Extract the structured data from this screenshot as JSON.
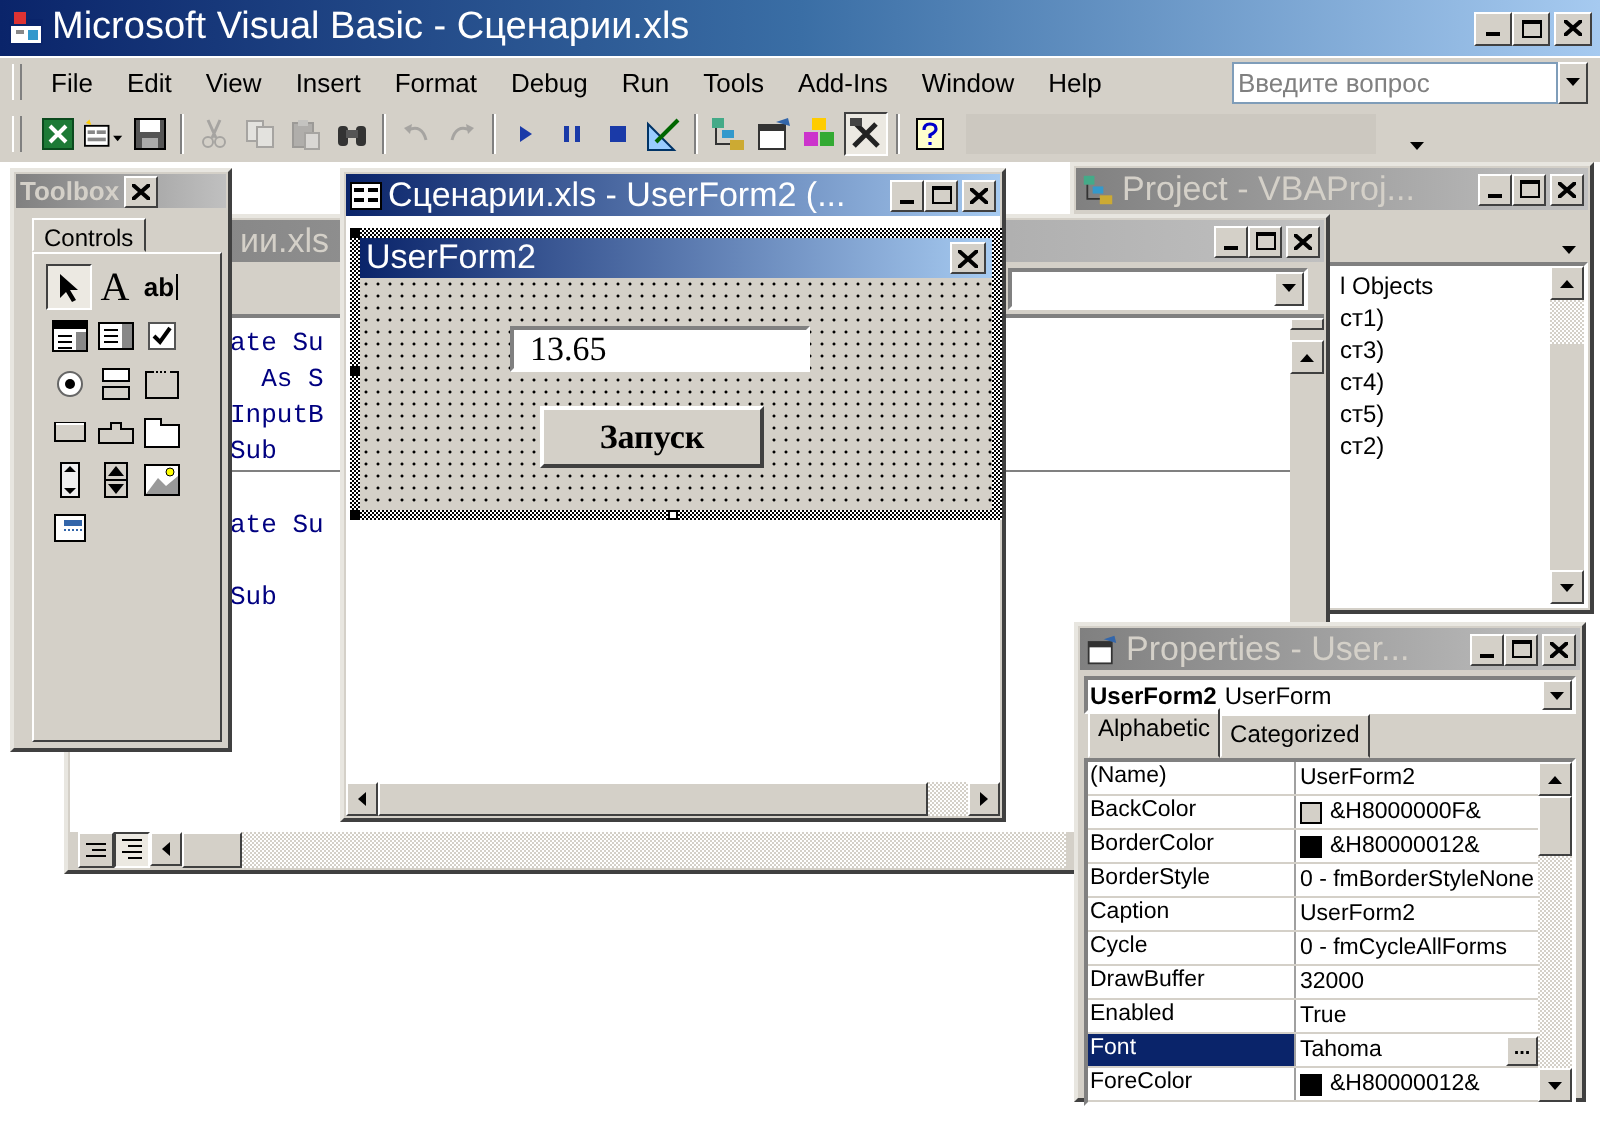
{
  "window": {
    "title": "Microsoft Visual Basic - Сценарии.xls"
  },
  "menu": [
    "File",
    "Edit",
    "View",
    "Insert",
    "Format",
    "Debug",
    "Run",
    "Tools",
    "Add-Ins",
    "Window",
    "Help"
  ],
  "help_box": {
    "placeholder": "Введите вопрос"
  },
  "toolbar": [
    {
      "kind": "excel",
      "disabled": false,
      "pressed": false
    },
    {
      "kind": "insert-form",
      "disabled": false,
      "pressed": false
    },
    {
      "kind": "save",
      "disabled": false,
      "pressed": false
    },
    {
      "kind": "separator"
    },
    {
      "kind": "cut",
      "disabled": true,
      "pressed": false
    },
    {
      "kind": "copy",
      "disabled": true,
      "pressed": false
    },
    {
      "kind": "paste",
      "disabled": true,
      "pressed": false
    },
    {
      "kind": "find",
      "disabled": false,
      "pressed": false
    },
    {
      "kind": "separator"
    },
    {
      "kind": "undo",
      "disabled": true,
      "pressed": false
    },
    {
      "kind": "redo",
      "disabled": true,
      "pressed": false
    },
    {
      "kind": "separator"
    },
    {
      "kind": "run",
      "disabled": false,
      "pressed": false
    },
    {
      "kind": "pause",
      "disabled": false,
      "pressed": false
    },
    {
      "kind": "stop",
      "disabled": false,
      "pressed": false
    },
    {
      "kind": "design",
      "disabled": false,
      "pressed": false
    },
    {
      "kind": "separator"
    },
    {
      "kind": "project",
      "disabled": false,
      "pressed": false
    },
    {
      "kind": "properties",
      "disabled": false,
      "pressed": false
    },
    {
      "kind": "browser",
      "disabled": false,
      "pressed": false
    },
    {
      "kind": "toolbox",
      "disabled": false,
      "pressed": true
    },
    {
      "kind": "separator"
    },
    {
      "kind": "help",
      "disabled": false,
      "pressed": false
    }
  ],
  "code_window": {
    "title": "ии.xls",
    "active": false,
    "lines": [
      {
        "kind": "code",
        "text": "ate Su"
      },
      {
        "kind": "code",
        "text": "  As S"
      },
      {
        "kind": "code",
        "text": "InputB"
      },
      {
        "kind": "code",
        "text": "Sub"
      },
      {
        "kind": "separator"
      },
      {
        "kind": "blank"
      },
      {
        "kind": "code",
        "text": "ate Su"
      },
      {
        "kind": "blank"
      },
      {
        "kind": "code",
        "text": "Sub"
      }
    ]
  },
  "project": {
    "title": "Project - VBAProj...",
    "active": false,
    "items": [
      "l Objects",
      "ст1)",
      "ст3)",
      "ст4)",
      "ст5)",
      "ст2)"
    ]
  },
  "properties": {
    "title": "Properties - User...",
    "active": false,
    "object": {
      "name": "UserForm2",
      "type": "UserForm"
    },
    "tabs": [
      {
        "label": "Alphabetic",
        "selected": true
      },
      {
        "label": "Categorized",
        "selected": false
      }
    ],
    "rows": [
      {
        "name": "(Name)",
        "value": "UserForm2",
        "selected": false
      },
      {
        "name": "BackColor",
        "value": "&H8000000F&",
        "color": "#d4d0c8",
        "selected": false
      },
      {
        "name": "BorderColor",
        "value": "&H80000012&",
        "color": "#000000",
        "selected": false
      },
      {
        "name": "BorderStyle",
        "value": "0 - fmBorderStyleNone",
        "selected": false
      },
      {
        "name": "Caption",
        "value": "UserForm2",
        "selected": false
      },
      {
        "name": "Cycle",
        "value": "0 - fmCycleAllForms",
        "selected": false
      },
      {
        "name": "DrawBuffer",
        "value": "32000",
        "selected": false
      },
      {
        "name": "Enabled",
        "value": "True",
        "selected": false
      },
      {
        "name": "Font",
        "value": "Tahoma",
        "button": "...",
        "selected": true
      },
      {
        "name": "ForeColor",
        "value": "&H80000012&",
        "color": "#000000",
        "selected": false
      }
    ]
  },
  "toolbox": {
    "title": "Toolbox",
    "active": false,
    "tab": "Controls",
    "tools": [
      {
        "kind": "pointer",
        "selected": true
      },
      {
        "kind": "label",
        "text": "A",
        "selected": false
      },
      {
        "kind": "textbox",
        "text": "ab",
        "selected": false
      },
      {
        "kind": "combobox",
        "selected": false
      },
      {
        "kind": "listbox",
        "selected": false
      },
      {
        "kind": "checkbox",
        "selected": false
      },
      {
        "kind": "option",
        "selected": false
      },
      {
        "kind": "toggle",
        "selected": false
      },
      {
        "kind": "frame",
        "selected": false
      },
      {
        "kind": "command",
        "selected": false
      },
      {
        "kind": "tabstrip",
        "selected": false
      },
      {
        "kind": "multipage",
        "selected": false
      },
      {
        "kind": "scrollbar",
        "selected": false
      },
      {
        "kind": "spin",
        "selected": false
      },
      {
        "kind": "image",
        "selected": false
      },
      {
        "kind": "refedit",
        "selected": false
      }
    ]
  },
  "form_window": {
    "title": "Сценарии.xls - UserForm2 (...",
    "active": true,
    "form": {
      "caption": "UserForm2",
      "textbox": {
        "value": "13.65"
      },
      "button": "Запуск"
    }
  }
}
